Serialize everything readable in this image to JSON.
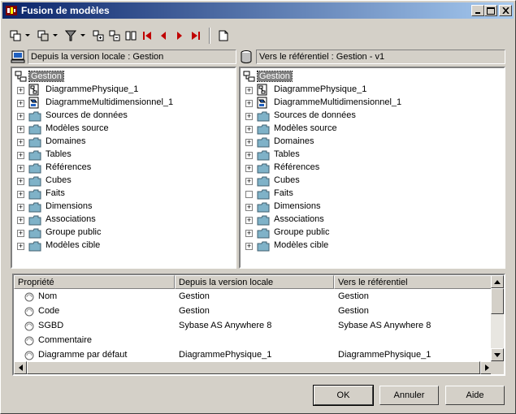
{
  "window": {
    "title": "Fusion de modèles"
  },
  "left_panel": {
    "header": "Depuis la version locale : Gestion"
  },
  "right_panel": {
    "header": "Vers le référentiel : Gestion - v1"
  },
  "tree": {
    "root": "Gestion",
    "items": [
      "DiagrammePhysique_1",
      "DiagrammeMultidimensionnel_1",
      "Sources de données",
      "Modèles source",
      "Domaines",
      "Tables",
      "Références",
      "Cubes",
      "Faits",
      "Dimensions",
      "Associations",
      "Groupe public",
      "Modèles cible"
    ]
  },
  "grid": {
    "columns": [
      "Propriété",
      "Depuis la version locale",
      "Vers le référentiel"
    ],
    "rows": [
      {
        "property": "Nom",
        "local": "Gestion",
        "repo": "Gestion"
      },
      {
        "property": "Code",
        "local": "Gestion",
        "repo": "Gestion"
      },
      {
        "property": "SGBD",
        "local": "Sybase AS Anywhere 8",
        "repo": "Sybase AS Anywhere 8"
      },
      {
        "property": "Commentaire",
        "local": "",
        "repo": ""
      },
      {
        "property": "Diagramme par défaut",
        "local": "DiagrammePhysique_1",
        "repo": "DiagrammePhysique_1"
      }
    ]
  },
  "buttons": {
    "ok": "OK",
    "cancel": "Annuler",
    "help": "Aide"
  },
  "colors": {
    "titlebar_start": "#0a246a",
    "titlebar_end": "#a6caf0",
    "folder": "#7fb2c8",
    "nav_red": "#c00000"
  }
}
